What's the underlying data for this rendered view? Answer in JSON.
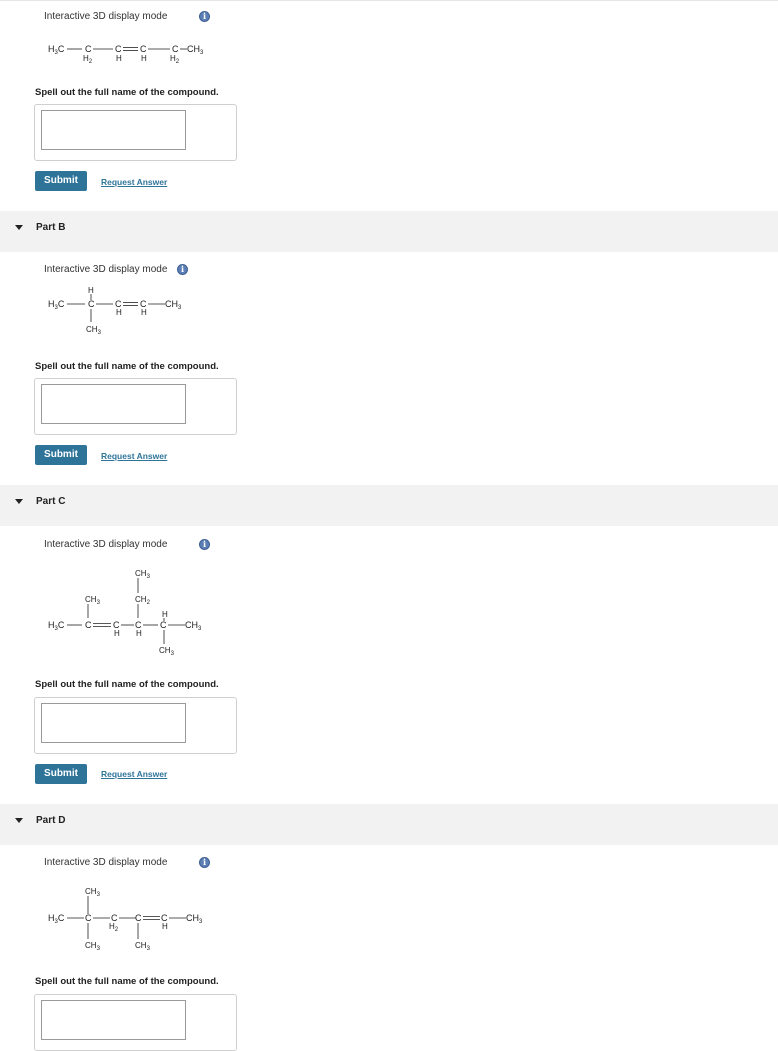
{
  "common": {
    "mode_label": "Interactive 3D display mode",
    "info_glyph": "i",
    "prompt": "Spell out the full name of the compound.",
    "submit_label": "Submit",
    "request_label": "Request Answer"
  },
  "parts": [
    {
      "label": "Part B"
    },
    {
      "label": "Part C"
    },
    {
      "label": "Part D"
    }
  ],
  "colors": {
    "button": "#2e7499",
    "link": "#2e7499",
    "info_icon": "#5b7fb5",
    "header_bg": "#f2f2f2"
  },
  "structures": {
    "a": {
      "left": "H3C",
      "c1": "C",
      "c1h": "H2",
      "c2": "C",
      "c2h": "H",
      "c3": "C",
      "c3h": "H",
      "c4": "C",
      "c4h": "H2",
      "right": "CH3"
    },
    "b": {
      "left": "H3C",
      "c1": "C",
      "c1top": "H",
      "c1bot": "CH3",
      "c2": "C",
      "c2h": "H",
      "c3": "C",
      "c3h": "H",
      "right": "CH3"
    },
    "c": {
      "left": "H3C",
      "c1": "C",
      "c1top": "CH3",
      "c2": "C",
      "c2h": "H",
      "c3": "C",
      "c3h": "H",
      "c3top": "CH2",
      "c3top2": "CH3",
      "c4": "C",
      "c4top": "H",
      "c4bot": "CH3",
      "right": "CH3"
    },
    "d": {
      "left": "H3C",
      "c1": "C",
      "c1top": "CH3",
      "c1bot": "CH3",
      "c2": "C",
      "c2h": "H2",
      "c2bot": "CH3",
      "c3": "C",
      "c4": "C",
      "c4h": "H",
      "right": "CH3"
    }
  }
}
